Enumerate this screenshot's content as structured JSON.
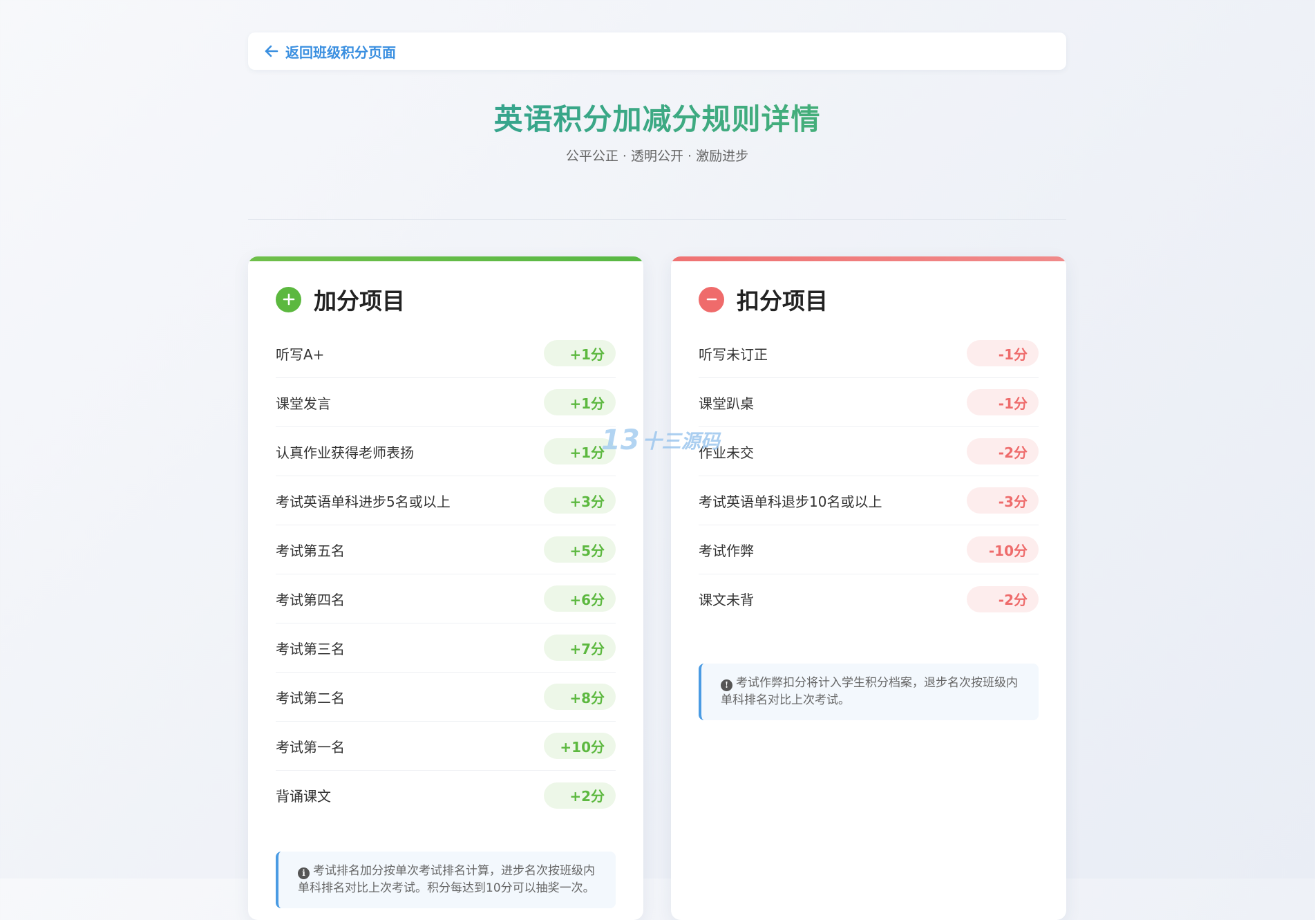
{
  "nav": {
    "back_label": "返回班级积分页面"
  },
  "header": {
    "title": "英语积分加减分规则详情",
    "subtitle": "公平公正 · 透明公开 · 激励进步"
  },
  "plus_card": {
    "title": "加分项目",
    "rules": [
      {
        "name": "听写A+",
        "points": "+1分"
      },
      {
        "name": "课堂发言",
        "points": "+1分"
      },
      {
        "name": "认真作业获得老师表扬",
        "points": "+1分"
      },
      {
        "name": "考试英语单科进步5名或以上",
        "points": "+3分"
      },
      {
        "name": "考试第五名",
        "points": "+5分"
      },
      {
        "name": "考试第四名",
        "points": "+6分"
      },
      {
        "name": "考试第三名",
        "points": "+7分"
      },
      {
        "name": "考试第二名",
        "points": "+8分"
      },
      {
        "name": "考试第一名",
        "points": "+10分"
      },
      {
        "name": "背诵课文",
        "points": "+2分"
      }
    ],
    "note": "考试排名加分按单次考试排名计算，进步名次按班级内单科排名对比上次考试。积分每达到10分可以抽奖一次。"
  },
  "minus_card": {
    "title": "扣分项目",
    "rules": [
      {
        "name": "听写未订正",
        "points": "-1分"
      },
      {
        "name": "课堂趴桌",
        "points": "-1分"
      },
      {
        "name": "作业未交",
        "points": "-2分"
      },
      {
        "name": "考试英语单科退步10名或以上",
        "points": "-3分"
      },
      {
        "name": "考试作弊",
        "points": "-10分"
      },
      {
        "name": "课文未背",
        "points": "-2分"
      }
    ],
    "note": "考试作弊扣分将计入学生积分档案，退步名次按班级内单科排名对比上次考试。"
  },
  "watermark": {
    "logo": "13",
    "text": "十三源码"
  },
  "colors": {
    "plus_accent": "#5cb83f",
    "minus_accent": "#ef6b6b",
    "link": "#3a8fe0",
    "note_border": "#4a9be3"
  },
  "icons": {
    "back": "arrow-left-icon",
    "plus_head": "plus-circle-icon",
    "minus_head": "minus-circle-icon",
    "note": "info-circle-icon"
  }
}
